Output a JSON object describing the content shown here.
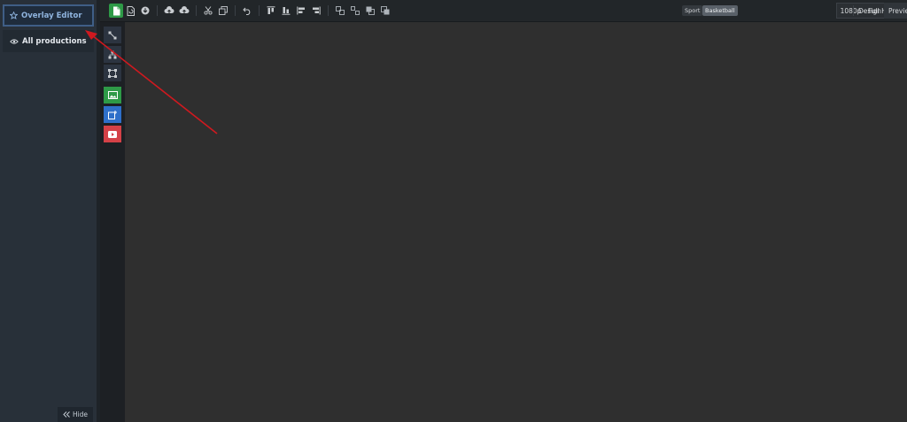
{
  "sidebar": {
    "active_item": {
      "label": "Overlay Editor",
      "icon": "star-icon"
    },
    "items": [
      {
        "label": "All productions",
        "icon": "eye-icon"
      }
    ],
    "hide_label": "Hide"
  },
  "toolbar": {
    "tags": {
      "sport": "Sport",
      "discipline": "Basketball"
    },
    "resolution": "1080p - Full HD - 1920 x 1080",
    "modes": {
      "design": "Design",
      "preview": "Previe"
    }
  },
  "colors": {
    "accent_green": "#2e9a47",
    "accent_blue": "#2e6fc9",
    "accent_red": "#d44147",
    "annotation_arrow": "#d0191f"
  }
}
